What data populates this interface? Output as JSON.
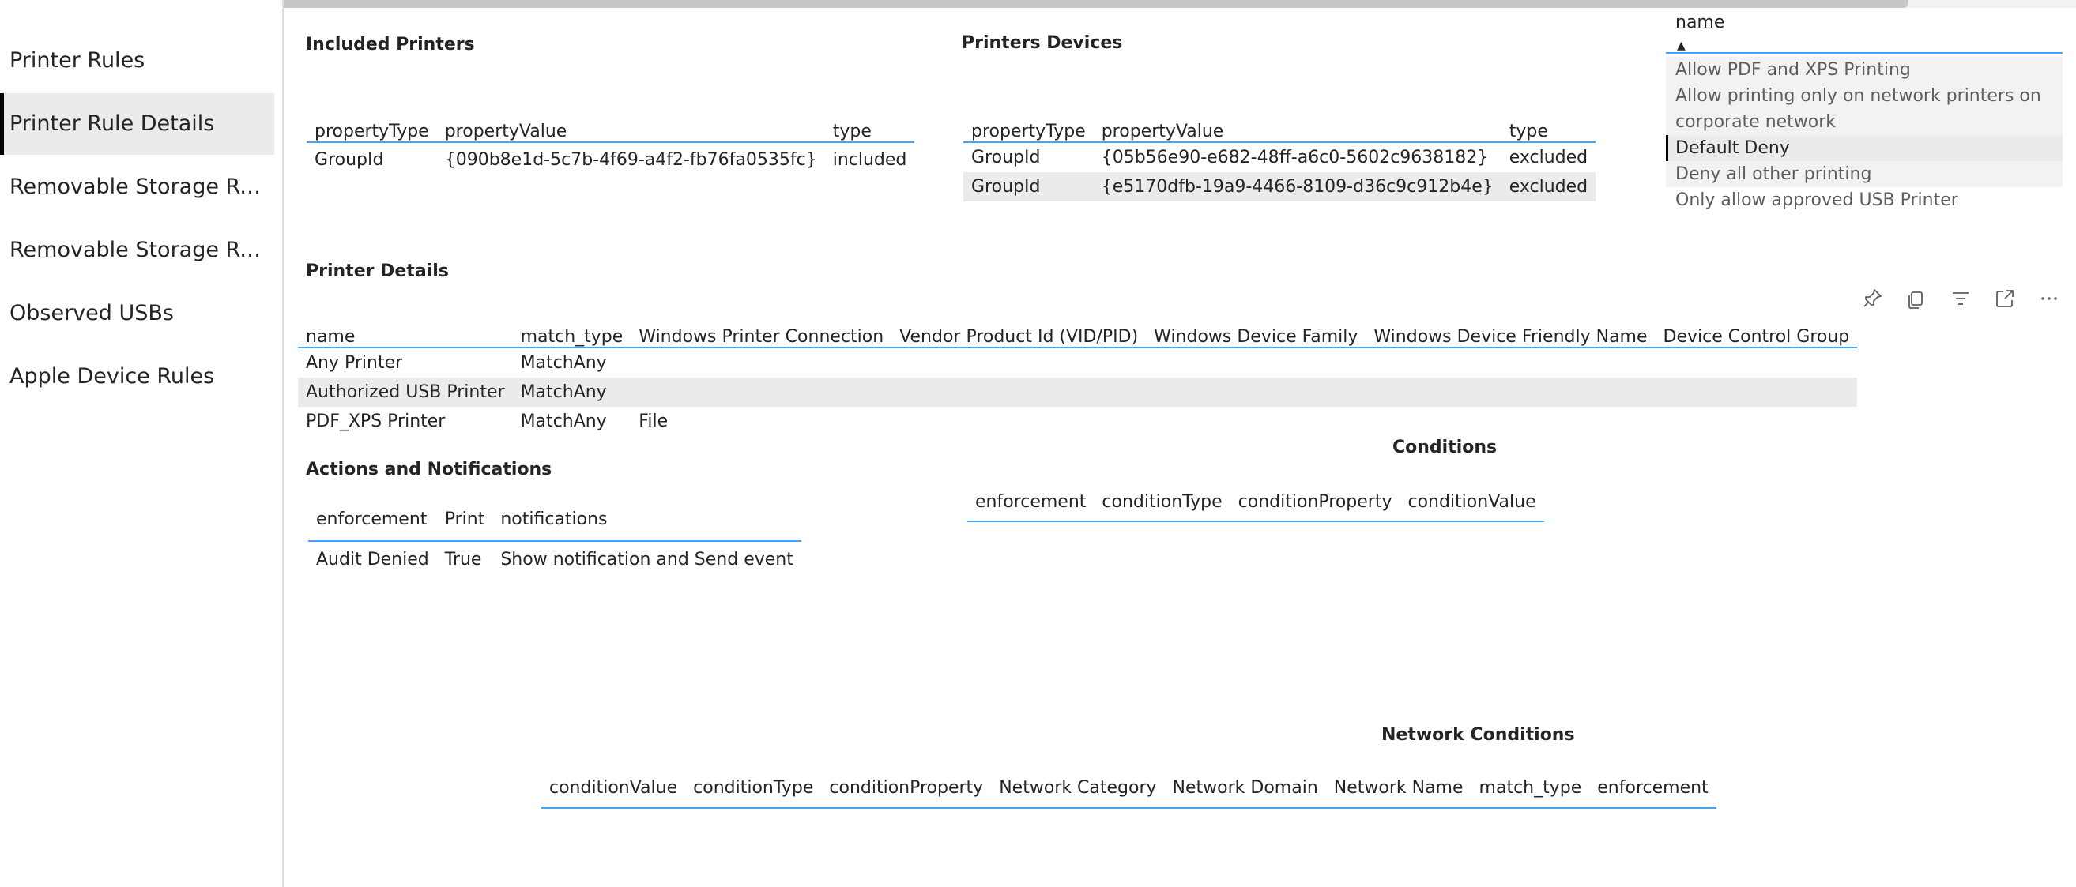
{
  "sidebar": {
    "items": [
      {
        "label": "Printer Rules"
      },
      {
        "label": "Printer Rule Details"
      },
      {
        "label": "Removable Storage Rules"
      },
      {
        "label": "Removable Storage Rul..."
      },
      {
        "label": "Observed USBs"
      },
      {
        "label": "Apple Device Rules"
      }
    ],
    "active_index": 1
  },
  "included_printers": {
    "title": "Included Printers",
    "columns": [
      "propertyType",
      "propertyValue",
      "type"
    ],
    "rows": [
      [
        "GroupId",
        "{090b8e1d-5c7b-4f69-a4f2-fb76fa0535fc}",
        "included"
      ]
    ]
  },
  "printers_devices": {
    "title": "Printers Devices",
    "columns": [
      "propertyType",
      "propertyValue",
      "type"
    ],
    "rows": [
      [
        "GroupId",
        "{05b56e90-e682-48ff-a6c0-5602c9638182}",
        "excluded"
      ],
      [
        "GroupId",
        "{e5170dfb-19a9-4466-8109-d36c9c912b4e}",
        "excluded"
      ]
    ]
  },
  "slicer": {
    "header": "name",
    "sort_icon": "sort-ascending-icon",
    "items": [
      {
        "label": "Allow PDF and XPS Printing"
      },
      {
        "label": "Allow printing only on network printers on"
      },
      {
        "label": "corporate network"
      },
      {
        "label": "Default Deny"
      },
      {
        "label": "Deny all other printing"
      },
      {
        "label": "Only allow approved USB Printer"
      }
    ],
    "selected": "Default Deny"
  },
  "printer_details": {
    "title": "Printer Details",
    "columns": [
      "name",
      "match_type",
      "Windows Printer Connection",
      "Vendor Product Id (VID/PID)",
      "Windows Device Family",
      "Windows Device Friendly Name",
      "Device Control Group"
    ],
    "rows": [
      [
        "Any Printer",
        "MatchAny",
        "",
        "",
        "",
        "",
        ""
      ],
      [
        "Authorized USB Printer",
        "MatchAny",
        "",
        "",
        "",
        "",
        ""
      ],
      [
        "PDF_XPS Printer",
        "MatchAny",
        "File",
        "",
        "",
        "",
        ""
      ]
    ]
  },
  "toolbar": {
    "icons": [
      "pin-icon",
      "copy-icon",
      "filter-icon",
      "focus-mode-icon",
      "more-options-icon"
    ]
  },
  "actions": {
    "title": "Actions and Notifications",
    "columns": [
      "enforcement",
      "Print",
      "notifications"
    ],
    "rows": [
      [
        "Audit Denied",
        "True",
        "Show notification and Send event"
      ]
    ]
  },
  "conditions": {
    "title": "Conditions",
    "columns": [
      "enforcement",
      "conditionType",
      "conditionProperty",
      "conditionValue"
    ]
  },
  "network_conditions": {
    "title": "Network Conditions",
    "columns": [
      "conditionValue",
      "conditionType",
      "conditionProperty",
      "Network Category",
      "Network Domain",
      "Network Name",
      "match_type",
      "enforcement"
    ]
  },
  "colors": {
    "accent": "#41a4ff",
    "selected_row": "#ebebeb"
  }
}
